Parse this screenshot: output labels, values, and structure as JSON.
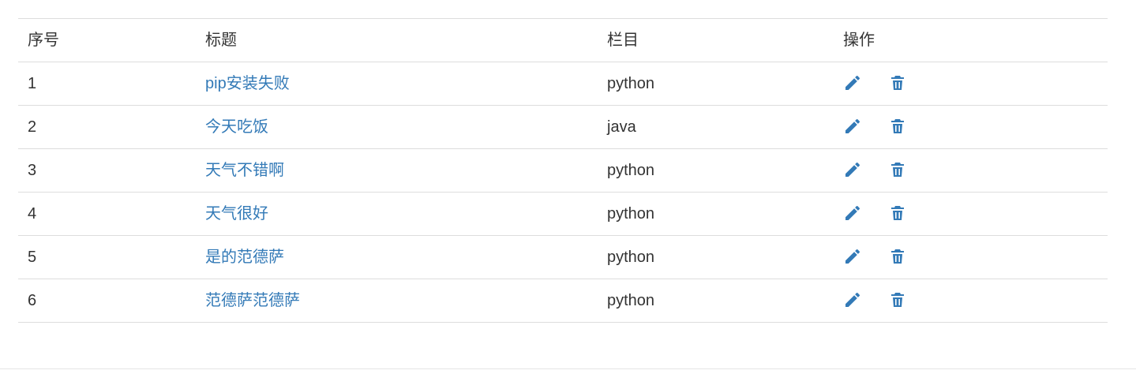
{
  "colors": {
    "link": "#337ab7",
    "text": "#333333",
    "border": "#dddddd"
  },
  "table": {
    "headers": {
      "index": "序号",
      "title": "标题",
      "column": "栏目",
      "actions": "操作"
    },
    "rows": [
      {
        "index": "1",
        "title": "pip安装失败",
        "column": "python",
        "actions": [
          "pencil-icon",
          "trash-icon"
        ]
      },
      {
        "index": "2",
        "title": "今天吃饭",
        "column": "java",
        "actions": [
          "pencil-icon",
          "trash-icon"
        ]
      },
      {
        "index": "3",
        "title": "天气不错啊",
        "column": "python",
        "actions": [
          "pencil-icon",
          "trash-icon"
        ]
      },
      {
        "index": "4",
        "title": "天气很好",
        "column": "python",
        "actions": [
          "pencil-icon",
          "trash-icon"
        ]
      },
      {
        "index": "5",
        "title": "是的范德萨",
        "column": "python",
        "actions": [
          "pencil-icon",
          "trash-icon"
        ]
      },
      {
        "index": "6",
        "title": "范德萨范德萨",
        "column": "python",
        "actions": [
          "pencil-icon",
          "trash-icon"
        ]
      }
    ]
  }
}
